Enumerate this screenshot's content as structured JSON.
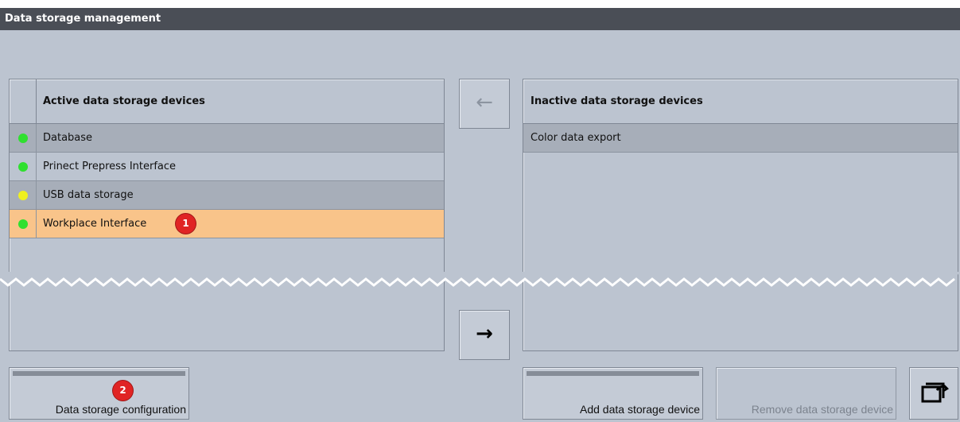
{
  "window": {
    "title": "Data storage management"
  },
  "active_panel": {
    "header": "Active data storage devices",
    "rows": [
      {
        "label": "Database",
        "status_color": "#2fe02f",
        "shade": "dark"
      },
      {
        "label": "Prinect Prepress Interface",
        "status_color": "#2fe02f",
        "shade": "light"
      },
      {
        "label": "USB data storage",
        "status_color": "#f0f020",
        "shade": "dark"
      },
      {
        "label": "Workplace Interface",
        "status_color": "#2fe02f",
        "shade": "selected"
      }
    ]
  },
  "inactive_panel": {
    "header": "Inactive data storage devices",
    "rows": [
      {
        "label": "Color data export",
        "shade": "dark"
      }
    ]
  },
  "move_left_button": {
    "glyph": "←",
    "enabled": false
  },
  "move_right_button": {
    "glyph": "→",
    "enabled": true
  },
  "buttons": {
    "configuration": "Data storage configuration",
    "add": "Add data storage device",
    "remove": "Remove data storage device",
    "exit_icon": "exit-icon"
  },
  "callouts": {
    "one": "1",
    "two": "2"
  },
  "colors": {
    "titlebar": "#4a4e56",
    "background": "#bcc4d0",
    "selected_row": "#f9c48a",
    "callout": "#e02424"
  }
}
